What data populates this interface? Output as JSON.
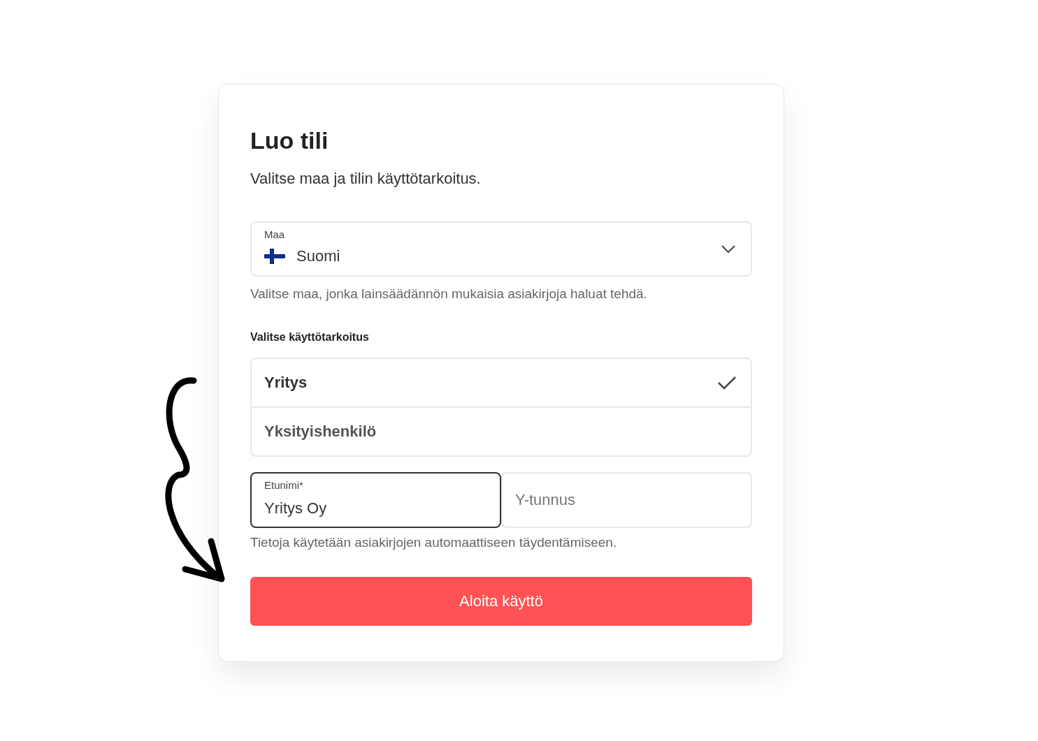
{
  "card": {
    "title": "Luo tili",
    "subtitle": "Valitse maa ja tilin käyttötarkoitus.",
    "country": {
      "label": "Maa",
      "value": "Suomi",
      "helper": "Valitse maa, jonka lainsäädännön mukaisia asiakirjoja haluat tehdä."
    },
    "purpose": {
      "label": "Valitse käyttötarkoitus",
      "options": [
        {
          "label": "Yritys",
          "selected": true
        },
        {
          "label": "Yksityishenkilö",
          "selected": false
        }
      ]
    },
    "name_fields": [
      {
        "label": "Etunimi*",
        "value": "Yritys Oy",
        "focused": true
      },
      {
        "placeholder": "Y-tunnus",
        "focused": false
      }
    ],
    "fields_helper": "Tietoja käytetään asiakirjojen automaattiseen täydentämiseen.",
    "button": "Aloita käyttö"
  }
}
